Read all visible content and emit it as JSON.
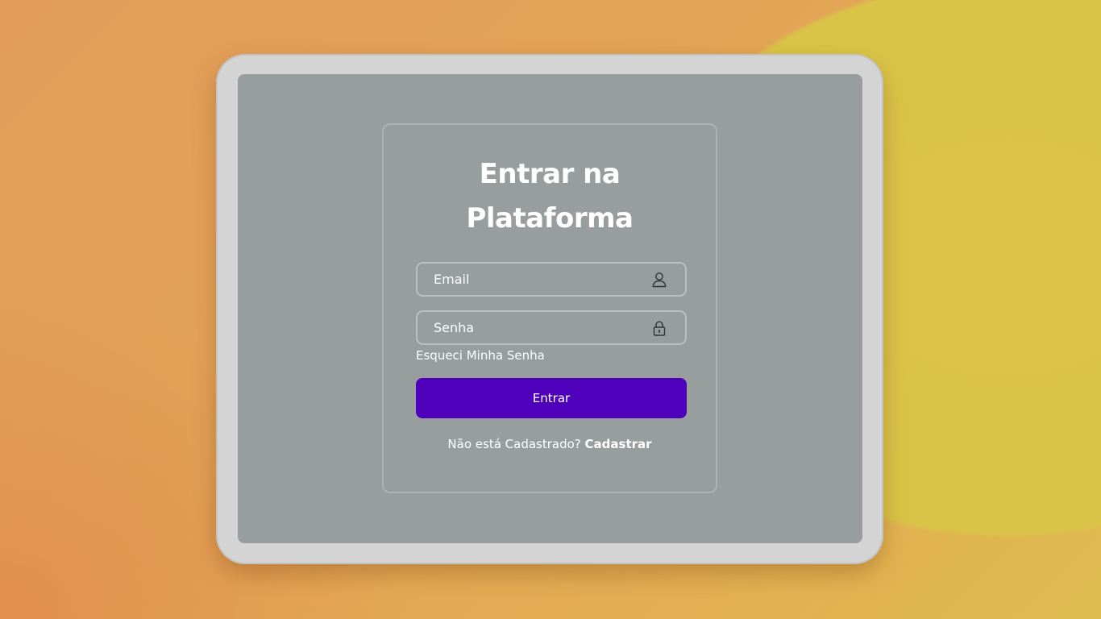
{
  "login": {
    "title_line1": "Entrar na",
    "title_line2": "Plataforma",
    "email_placeholder": "Email",
    "password_placeholder": "Senha",
    "forgot_password": "Esqueci Minha Senha",
    "submit_label": "Entrar",
    "register_prompt": "Não está Cadastrado?",
    "register_link": "Cadastrar"
  },
  "icons": {
    "email": "user-icon",
    "password": "lock-icon"
  },
  "colors": {
    "accent": "#4f00ba",
    "screen": "#989e9d",
    "tablet_frame": "#d4d4d4"
  }
}
